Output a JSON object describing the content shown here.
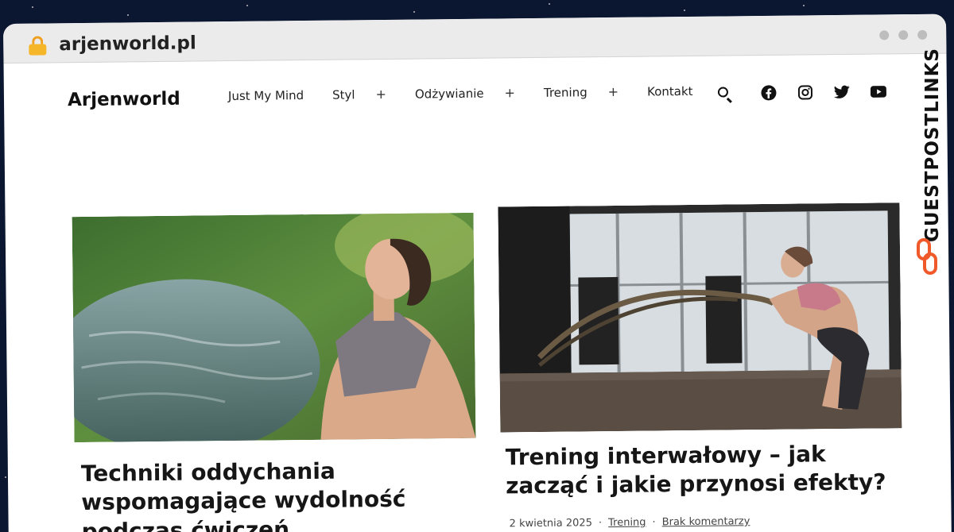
{
  "browser": {
    "url": "arjenworld.pl"
  },
  "site": {
    "logo": "Arjenworld",
    "nav": [
      {
        "label": "Just My Mind",
        "has_submenu": false
      },
      {
        "label": "Styl",
        "has_submenu": true
      },
      {
        "label": "Odżywianie",
        "has_submenu": true
      },
      {
        "label": "Trening",
        "has_submenu": true
      },
      {
        "label": "Kontakt",
        "has_submenu": false
      }
    ],
    "submenu_glyph": "+",
    "icons": [
      "search-icon",
      "facebook-icon",
      "instagram-icon",
      "twitter-icon",
      "youtube-icon"
    ]
  },
  "posts": [
    {
      "title": "Techniki oddychania wspomagające wydolność podczas ćwiczeń"
    },
    {
      "title": "Trening interwałowy – jak zacząć i jakie przynosi efekty?",
      "date": "2 kwietnia 2025",
      "category": "Trening",
      "comments": "Brak komentarzy",
      "separator": "·"
    }
  ],
  "watermark": {
    "text": "GUESTPOSTLINKS",
    "accent": "#f0592a"
  }
}
